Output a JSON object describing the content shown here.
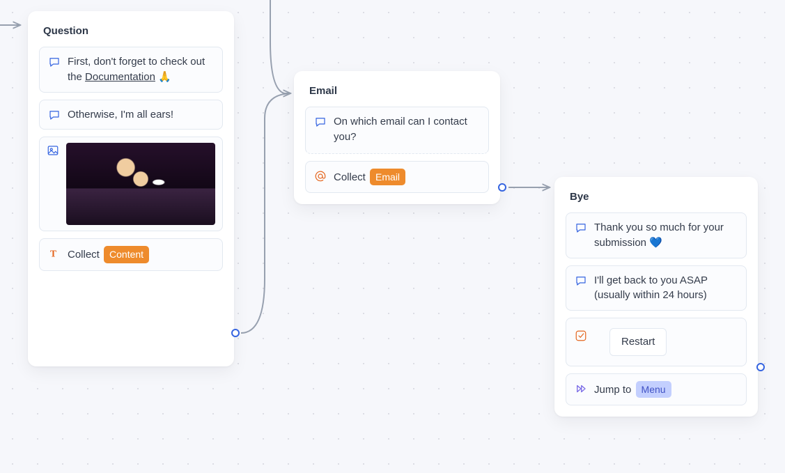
{
  "nodes": {
    "question": {
      "title": "Question",
      "line1_a": "First, don't forget to check out the ",
      "line1_link": "Documentation",
      "line1_emoji": "🙏",
      "line2": "Otherwise, I'm all ears!",
      "collect_label": "Collect",
      "collect_var": "Content"
    },
    "email": {
      "title": "Email",
      "line1": "On which email can I contact you?",
      "collect_label": "Collect",
      "collect_var": "Email"
    },
    "bye": {
      "title": "Bye",
      "line1": "Thank you so much for your submission 💙",
      "line2": "I'll get back to you ASAP (usually within 24 hours)",
      "restart_label": "Restart",
      "jump_label": "Jump to",
      "jump_target": "Menu"
    }
  }
}
